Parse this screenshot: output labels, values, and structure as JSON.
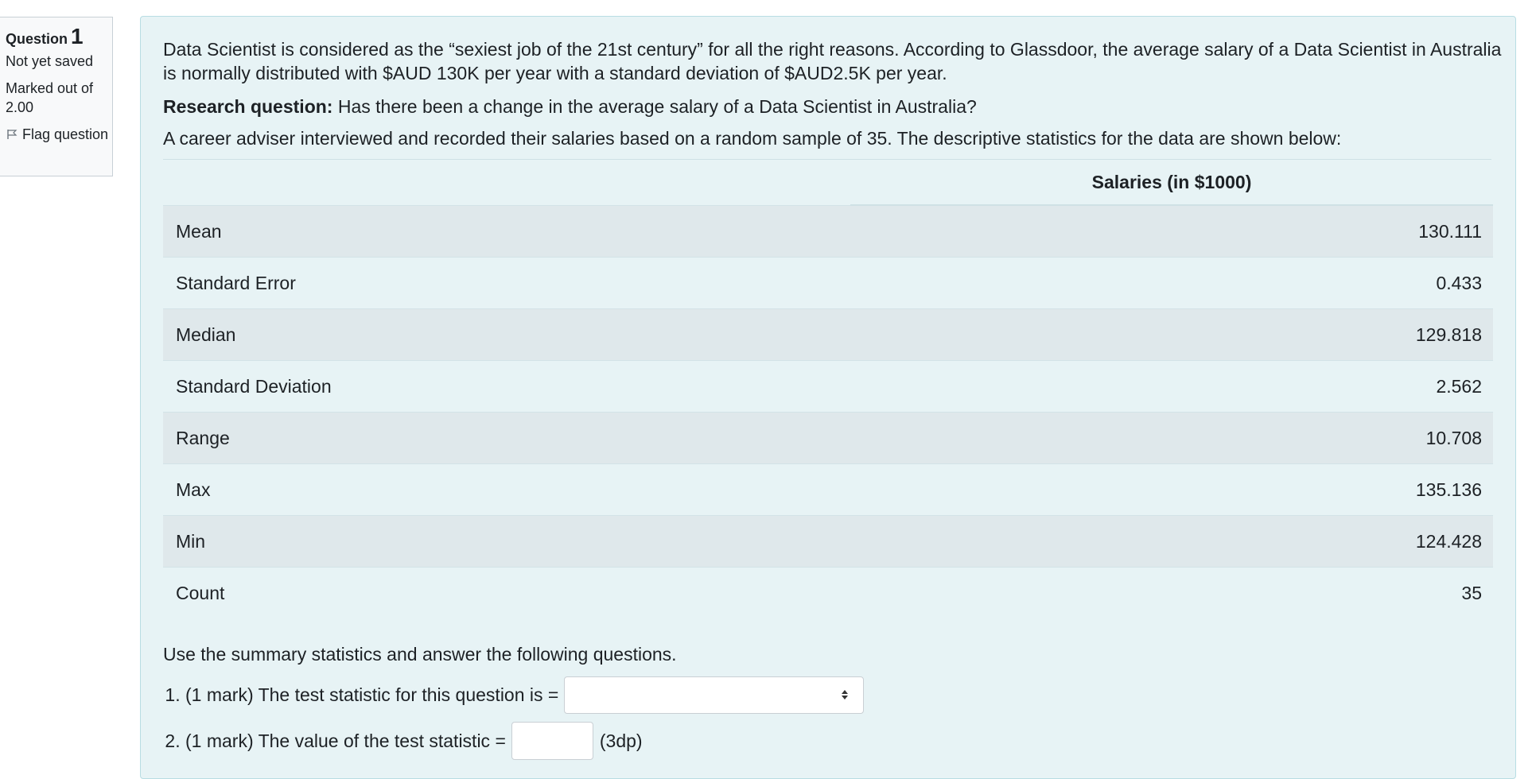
{
  "question_info": {
    "question_word": "Question",
    "question_number": "1",
    "state": "Not yet saved",
    "grade": "Marked out of 2.00",
    "flag_label": "Flag question"
  },
  "content": {
    "intro": "Data Scientist is considered as the “sexiest job of the 21st century” for all the right reasons. According to Glassdoor, the average salary of a Data Scientist in Australia is normally distributed with $AUD 130K per year with a standard deviation of $AUD2.5K per year.",
    "research_label": "Research question:",
    "research_text": " Has there been a change in the average salary of a Data Scientist in Australia?",
    "sample_text": "A career adviser interviewed and recorded their salaries based on a random sample of 35. The descriptive statistics for the data are shown below:",
    "table": {
      "header": "Salaries (in $1000)",
      "rows": [
        {
          "label": "Mean",
          "value": "130.111"
        },
        {
          "label": "Standard Error",
          "value": "0.433"
        },
        {
          "label": "Median",
          "value": "129.818"
        },
        {
          "label": "Standard Deviation",
          "value": "2.562"
        },
        {
          "label": "Range",
          "value": "10.708"
        },
        {
          "label": "Max",
          "value": "135.136"
        },
        {
          "label": "Min",
          "value": "124.428"
        },
        {
          "label": "Count",
          "value": "35"
        }
      ]
    },
    "instruction": "Use the summary statistics and answer the following questions.",
    "parts": [
      {
        "text": "(1 mark) The test statistic for this question is =",
        "selected": ""
      },
      {
        "text": "(1 mark) The value of the test statistic =",
        "value": "",
        "suffix": "(3dp)"
      }
    ]
  }
}
